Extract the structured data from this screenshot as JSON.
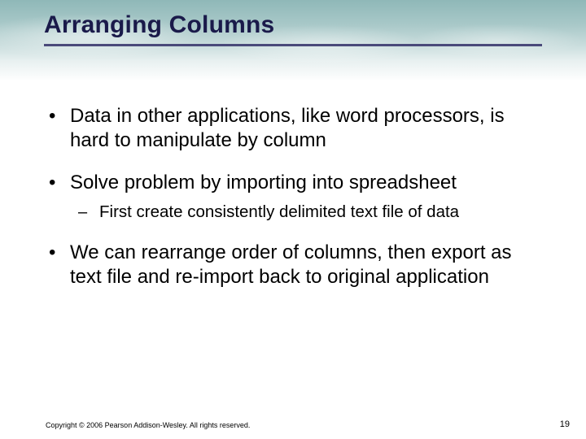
{
  "title": "Arranging Columns",
  "bullets": [
    {
      "text": "Data in other applications, like word processors, is hard to manipulate by column"
    },
    {
      "text": "Solve problem by importing into spreadsheet",
      "sub": [
        "First create consistently delimited text file of data"
      ]
    },
    {
      "text": "We can rearrange order of columns, then export as text file and re-import back to original application"
    }
  ],
  "footer": {
    "copyright": "Copyright © 2006 Pearson Addison-Wesley. All rights reserved.",
    "page": "19"
  }
}
